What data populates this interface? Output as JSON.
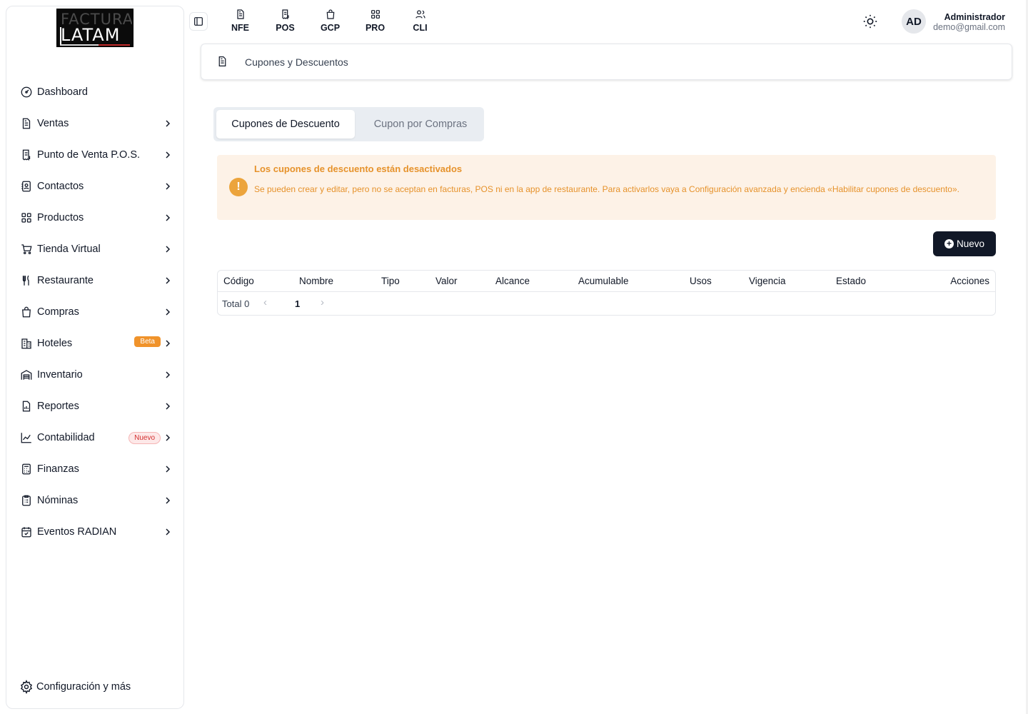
{
  "logo": {
    "line1": "FACTURA",
    "line2": "LATAM"
  },
  "sidebar": {
    "items": [
      {
        "label": "Dashboard",
        "icon": "gauge-icon"
      },
      {
        "label": "Ventas",
        "icon": "file-text-icon"
      },
      {
        "label": "Punto de Venta P.O.S.",
        "icon": "receipt-icon"
      },
      {
        "label": "Contactos",
        "icon": "contacts-icon"
      },
      {
        "label": "Productos",
        "icon": "grid-icon"
      },
      {
        "label": "Tienda Virtual",
        "icon": "cart-icon"
      },
      {
        "label": "Restaurante",
        "icon": "utensils-icon"
      },
      {
        "label": "Compras",
        "icon": "shopping-bag-icon"
      },
      {
        "label": "Hoteles",
        "icon": "building-icon",
        "badge": "Beta"
      },
      {
        "label": "Inventario",
        "icon": "warehouse-icon"
      },
      {
        "label": "Reportes",
        "icon": "report-icon"
      },
      {
        "label": "Contabilidad",
        "icon": "chart-line-icon",
        "badge": "Nuevo"
      },
      {
        "label": "Finanzas",
        "icon": "calculator-icon"
      },
      {
        "label": "Nóminas",
        "icon": "clipboard-icon"
      },
      {
        "label": "Eventos RADIAN",
        "icon": "calendar-check-icon"
      }
    ],
    "config_label": "Configuración y más"
  },
  "topbar": {
    "modules": [
      {
        "label": "NFE",
        "icon": "file-text-icon"
      },
      {
        "label": "POS",
        "icon": "receipt-icon"
      },
      {
        "label": "GCP",
        "icon": "shopping-bag-icon"
      },
      {
        "label": "PRO",
        "icon": "grid-icon"
      },
      {
        "label": "CLI",
        "icon": "users-icon"
      }
    ],
    "avatar_initials": "AD",
    "user_name": "Administrador",
    "user_email": "demo@gmail.com"
  },
  "breadcrumb": {
    "title": "Cupones y Descuentos"
  },
  "tabs": {
    "active": "Cupones de Descuento",
    "inactive": "Cupon por Compras"
  },
  "alert": {
    "icon": "!",
    "title": "Los cupones de descuento están desactivados",
    "text": "Se pueden crear y editar, pero no se aceptan en facturas, POS ni en la app de restaurante. Para activarlos vaya a Configuración avanzada y encienda «Habilitar cupones de descuento»."
  },
  "new_button": {
    "label": "Nuevo"
  },
  "table": {
    "columns": [
      "Código",
      "Nombre",
      "Tipo",
      "Valor",
      "Alcance",
      "Acumulable",
      "Usos",
      "Vigencia",
      "Estado",
      "Acciones"
    ],
    "rows": [],
    "total_label": "Total 0",
    "current_page": "1"
  },
  "colors": {
    "accent_dark": "#111827",
    "warning": "#e6922b",
    "warning_bg": "#fdf2e7",
    "beta_badge": "#f0932b"
  }
}
